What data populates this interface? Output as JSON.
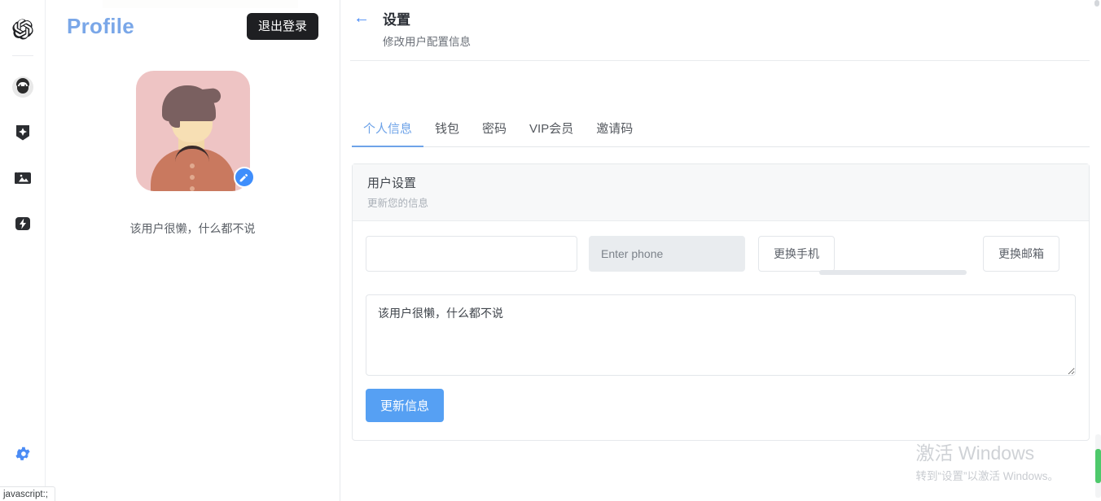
{
  "rail": {
    "logo_icon": "openai-logo-icon",
    "items": [
      {
        "icon": "user-avatar-icon",
        "name": "rail-item-account"
      },
      {
        "icon": "badge-sparkle-icon",
        "name": "rail-item-badge"
      },
      {
        "icon": "image-gallery-icon",
        "name": "rail-item-gallery"
      },
      {
        "icon": "lightning-flash-icon",
        "name": "rail-item-flash"
      }
    ],
    "bottom_icon": "gear-icon"
  },
  "profile": {
    "title": "Profile",
    "logout_label": "退出登录",
    "avatar_alt": "user-avatar",
    "edit_icon": "pencil-edit-icon",
    "bio": "该用户很懒，什么都不说"
  },
  "page": {
    "back_icon": "arrow-left-icon",
    "title": "设置",
    "subtitle": "修改用户配置信息"
  },
  "tabs": [
    {
      "label": "个人信息",
      "active": true
    },
    {
      "label": "钱包",
      "active": false
    },
    {
      "label": "密码",
      "active": false
    },
    {
      "label": "VIP会员",
      "active": false
    },
    {
      "label": "邀请码",
      "active": false
    }
  ],
  "card": {
    "title": "用户设置",
    "subtitle": "更新您的信息",
    "form": {
      "nickname_value": "",
      "nickname_placeholder": "",
      "phone_value": "",
      "phone_placeholder": "Enter phone",
      "change_phone_label": "更换手机",
      "change_email_label": "更换邮箱",
      "bio_value": "该用户很懒，什么都不说",
      "bio_placeholder": "",
      "submit_label": "更新信息"
    }
  },
  "watermark": {
    "line1": "激活 Windows",
    "line2": "转到“设置”以激活 Windows。"
  },
  "statusbar": {
    "text": "javascript:;"
  },
  "colors": {
    "accent_blue": "#56a0f3",
    "title_blue": "#7aa7e8",
    "logout_dark": "#1e1f22",
    "scroll_green": "#4ec96b",
    "avatar_bg": "#eec4c4"
  }
}
